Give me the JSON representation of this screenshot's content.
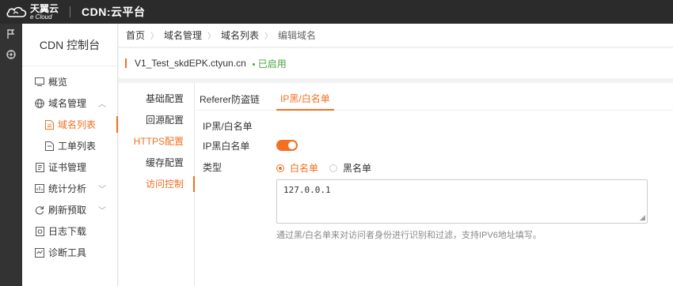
{
  "topbar": {
    "logo_cn": "天翼云",
    "logo_en": "e Cloud",
    "product": "CDN:云平台"
  },
  "rail": {
    "icons": [
      "flag-icon",
      "dashboard-icon"
    ]
  },
  "sidebar": {
    "title": "CDN 控制台",
    "items": [
      {
        "label": "概览",
        "icon": "overview-icon"
      },
      {
        "label": "域名管理",
        "icon": "globe-icon"
      },
      {
        "label": "域名列表",
        "icon": "document-icon"
      },
      {
        "label": "工单列表",
        "icon": "ticket-icon"
      },
      {
        "label": "证书管理",
        "icon": "certificate-icon"
      },
      {
        "label": "统计分析",
        "icon": "chart-icon"
      },
      {
        "label": "刷新预取",
        "icon": "refresh-icon"
      },
      {
        "label": "日志下载",
        "icon": "log-icon"
      },
      {
        "label": "诊断工具",
        "icon": "diagnose-icon"
      }
    ]
  },
  "breadcrumb": [
    "首页",
    "域名管理",
    "域名列表",
    "编辑域名"
  ],
  "domain": {
    "name": "V1_Test_skdEPK.ctyun.cn",
    "status": "已启用",
    "accent_color": "#f36f21",
    "status_color": "#45a33b"
  },
  "subnav": [
    "基础配置",
    "回源配置",
    "HTTPS配置",
    "缓存配置",
    "访问控制"
  ],
  "tabs": [
    "Referer防盗链",
    "IP黑/白名单"
  ],
  "form": {
    "section_title": "IP黑/白名单",
    "toggle_label": "IP黑白名单",
    "type_label": "类型",
    "option_white": "白名单",
    "option_black": "黑名单",
    "ip_list": "127.0.0.1",
    "hint": "通过黑/白名单来对访问者身份进行识别和过滤，支持IPV6地址填写。"
  }
}
